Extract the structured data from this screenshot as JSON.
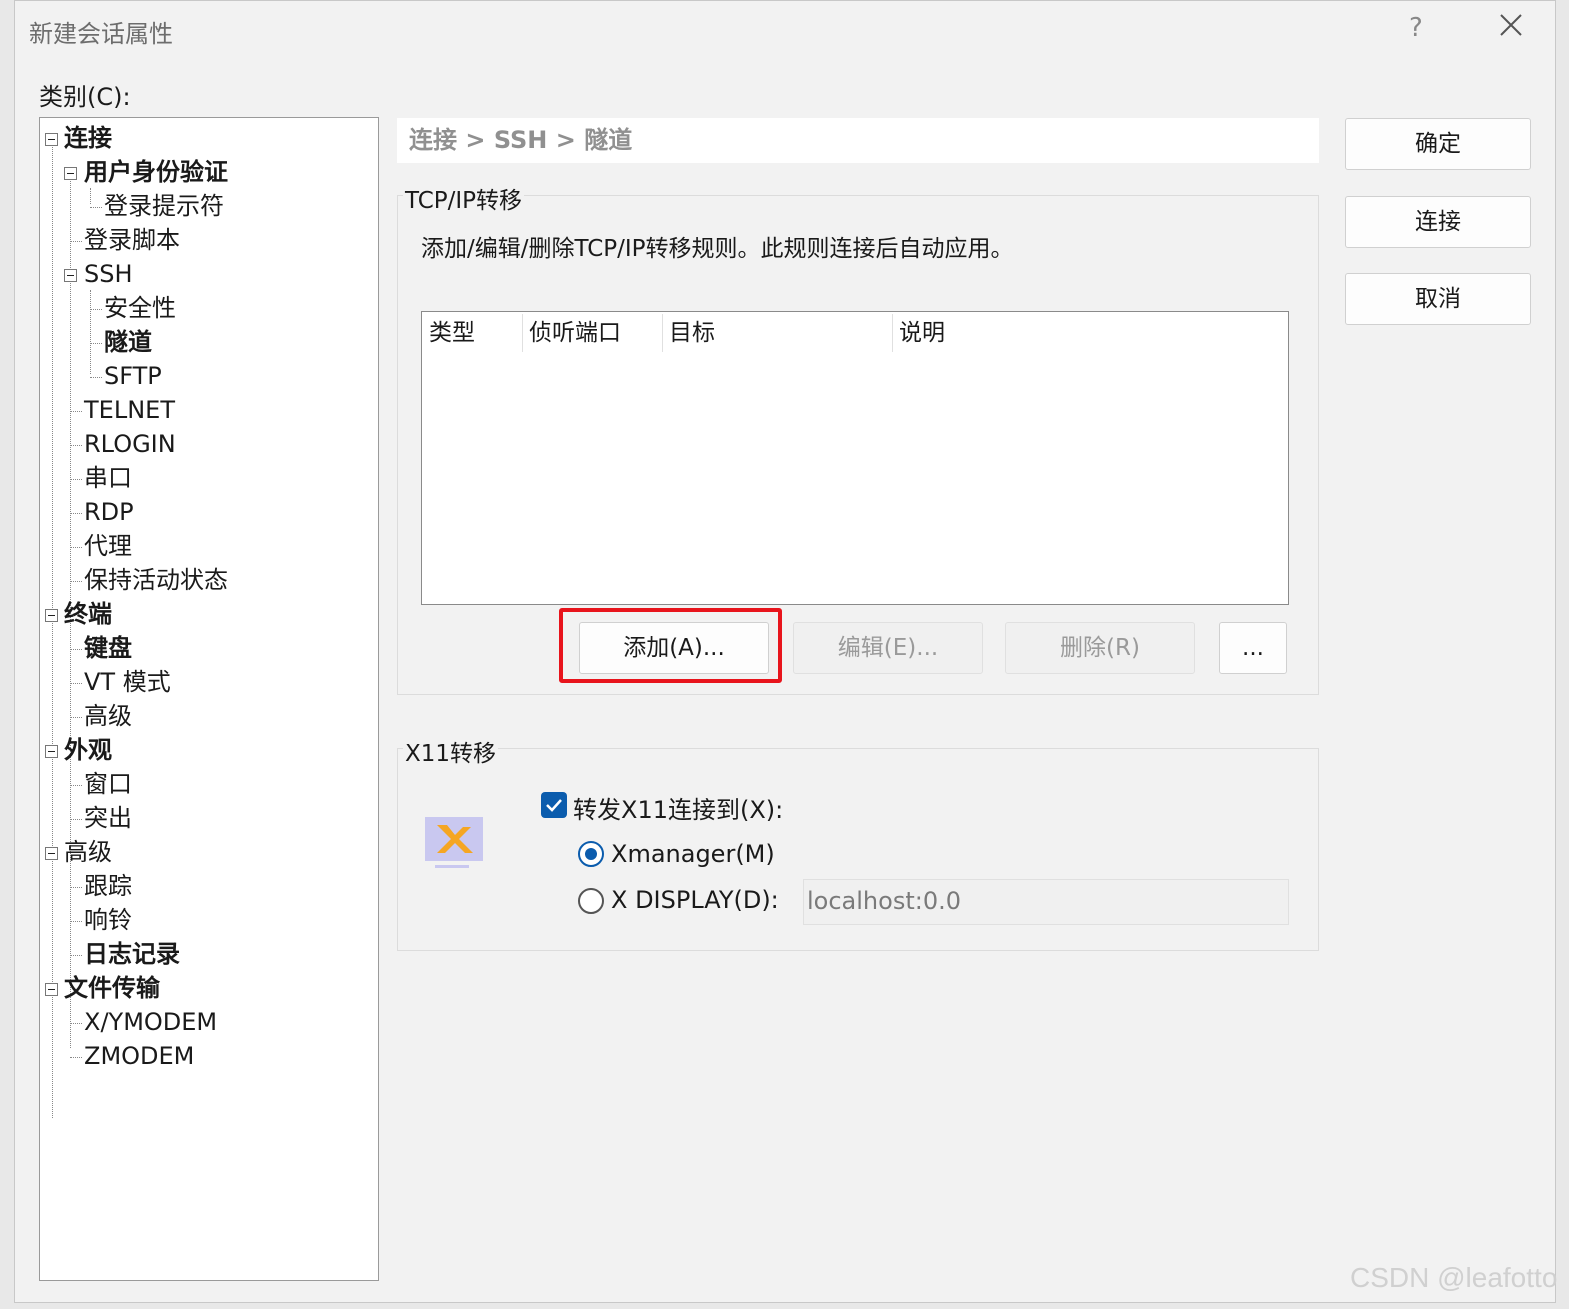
{
  "window": {
    "title": "新建会话属性",
    "help": "?"
  },
  "category_label": "类别(C):",
  "tree": {
    "items": [
      {
        "label": "连接",
        "bold": true
      },
      {
        "label": "用户身份验证",
        "bold": true
      },
      {
        "label": "登录提示符",
        "bold": false
      },
      {
        "label": "登录脚本",
        "bold": false
      },
      {
        "label": "SSH",
        "bold": false
      },
      {
        "label": "安全性",
        "bold": false
      },
      {
        "label": "隧道",
        "bold": true,
        "selected": true
      },
      {
        "label": "SFTP",
        "bold": false
      },
      {
        "label": "TELNET",
        "bold": false
      },
      {
        "label": "RLOGIN",
        "bold": false
      },
      {
        "label": "串口",
        "bold": false
      },
      {
        "label": "RDP",
        "bold": false
      },
      {
        "label": "代理",
        "bold": false
      },
      {
        "label": "保持活动状态",
        "bold": false
      },
      {
        "label": "终端",
        "bold": true
      },
      {
        "label": "键盘",
        "bold": true
      },
      {
        "label": "VT 模式",
        "bold": false
      },
      {
        "label": "高级",
        "bold": false
      },
      {
        "label": "外观",
        "bold": true
      },
      {
        "label": "窗口",
        "bold": false
      },
      {
        "label": "突出",
        "bold": false
      },
      {
        "label": "高级",
        "bold": false
      },
      {
        "label": "跟踪",
        "bold": false
      },
      {
        "label": "响铃",
        "bold": false
      },
      {
        "label": "日志记录",
        "bold": true
      },
      {
        "label": "文件传输",
        "bold": true
      },
      {
        "label": "X/YMODEM",
        "bold": false
      },
      {
        "label": "ZMODEM",
        "bold": false
      }
    ]
  },
  "breadcrumb": "连接 > SSH > 隧道",
  "tcp": {
    "title": "TCP/IP转移",
    "description": "添加/编辑/删除TCP/IP转移规则。此规则连接后自动应用。",
    "columns": [
      "类型",
      "侦听端口",
      "目标",
      "说明"
    ],
    "add_label": "添加(A)...",
    "edit_label": "编辑(E)...",
    "delete_label": "删除(R)",
    "more_label": "..."
  },
  "x11": {
    "title": "X11转移",
    "forward_label": "转发X11连接到(X):",
    "forward_checked": true,
    "xmanager_label": "Xmanager(M)",
    "display_label": "X DISPLAY(D):",
    "display_value": "localhost:0.0",
    "selected": "Xmanager(M)"
  },
  "buttons": {
    "ok": "确定",
    "connect": "连接",
    "cancel": "取消"
  },
  "watermark": "CSDN @leafotto",
  "colors": {
    "accent": "#0b5cad",
    "highlight_box": "#e8141c",
    "logo_orange": "#f5a623",
    "logo_bg": "#c9c8f0"
  }
}
